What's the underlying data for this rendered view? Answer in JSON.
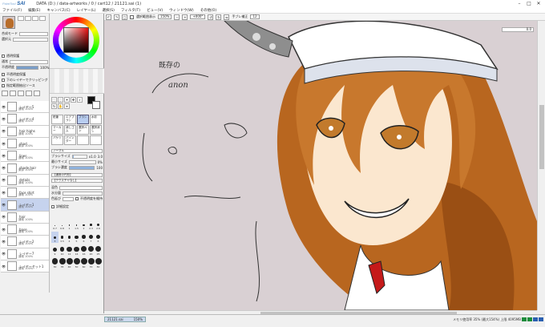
{
  "app": {
    "logo": "SAI",
    "logo_small": "PaintTool",
    "title": "DATA (D:) / data-artworks / 0 / cart12 / 21121.sai (1)",
    "window": {
      "minimize": "–",
      "maximize": "□",
      "close": "✕"
    }
  },
  "menu": [
    "ファイル(F)",
    "編集(E)",
    "キャンバス(C)",
    "レイヤー(L)",
    "選択(S)",
    "フィルタ(T)",
    "ビュー(V)",
    "ウィンドウ(W)",
    "その他(O)"
  ],
  "toolbar": {
    "selection_label": "選択範囲表示",
    "zoom": "150%",
    "rotation": "+000°",
    "stabilizer_label": "手ブレ補正",
    "stabilizer_value": "12"
  },
  "navigator": {
    "layer_mode_label": "合成モード",
    "opacity_label": "不透明度",
    "opacity_value": "100%",
    "opacity_pct": 100,
    "mode_value": "通常",
    "protect_label": "透明保護",
    "clip_label": "クリッピング",
    "layer_select_label": "選択元",
    "options": [
      "不透明度保護",
      "下のレイヤーでクリッピング",
      "指定範囲抽出ソース"
    ]
  },
  "layers": [
    {
      "name": "レイヤー5",
      "sub": "通常 100%"
    },
    {
      "name": "レイヤー4",
      "sub": "通常 100%"
    },
    {
      "name": "hair highs",
      "sub": "通常 100%"
    },
    {
      "name": "shad",
      "sub": "乗算 100%"
    },
    {
      "name": "lines",
      "sub": "通常 100%"
    },
    {
      "name": "shade hair",
      "sub": "乗算 100%"
    },
    {
      "name": "details",
      "sub": "通常 100%"
    },
    {
      "name": "face shirt",
      "sub": "通常 100%"
    },
    {
      "name": "レイヤー1",
      "sub": "通常 100%",
      "selected": true
    },
    {
      "name": "hair",
      "sub": "通常 100%"
    },
    {
      "name": "base",
      "sub": "通常 100%"
    },
    {
      "name": "レイヤー2",
      "sub": "通常 100%"
    },
    {
      "name": "レイヤー7",
      "sub": "通常 100%"
    },
    {
      "name": "レイヤーセット1",
      "sub": "通常 100%"
    }
  ],
  "tools_panel": {
    "brushes": [
      "鉛筆",
      "エアブラシ",
      "ブラシ",
      "水彩",
      "マーカー",
      "消しゴム",
      "選択ペン",
      "選択消し",
      "バケツ",
      "バインダー",
      "",
      ""
    ],
    "mode_label": "ノーマル",
    "size_label": "ブラシサイズ",
    "size_mult": "x1.0",
    "size_value": "3.0",
    "size_pct": 3,
    "min_size_label": "最小サイズ",
    "min_size_value": "0%",
    "min_size_pct": 0,
    "density_label": "ブラシ濃度",
    "density_value": "100",
    "density_pct": 100,
    "shape_label": "【通常の円形】",
    "texture_label": "【テクスチャなし】",
    "blend_label": "混色",
    "water_label": "水分量",
    "persist_label": "色延び",
    "keep_opacity_label": "不透明度を維持",
    "detail_label": "詳細設定",
    "sizes": [
      "0.7",
      "0.8",
      "1",
      "1.5",
      "2",
      "2.3",
      "2.6",
      "3",
      "3.5",
      "4",
      "5",
      "6",
      "7",
      "8",
      "9",
      "10",
      "12",
      "14",
      "16",
      "20",
      "25",
      "30",
      "35",
      "40",
      "50",
      "60",
      "70",
      "80"
    ],
    "selected_size": "3"
  },
  "canvas": {
    "annotation_top": "既存の",
    "annotation_bottom": "anon",
    "zoom_display": "0.0"
  },
  "status": {
    "tab_name": "21121.sai",
    "tab_zoom": "150%",
    "memory": "メモリ使用率 35% (最大154%)   上限 4095MB"
  }
}
